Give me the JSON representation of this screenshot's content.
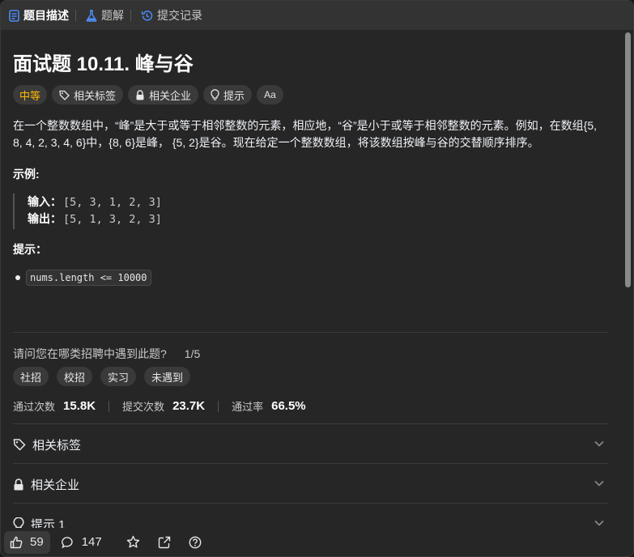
{
  "tabs": [
    {
      "label": "题目描述",
      "icon": "document-icon",
      "active": true
    },
    {
      "label": "题解",
      "icon": "flask-icon",
      "active": false
    },
    {
      "label": "提交记录",
      "icon": "history-icon",
      "active": false
    }
  ],
  "problem": {
    "title": "面试题 10.11. 峰与谷",
    "difficulty": "中等",
    "tag_buttons": [
      "相关标签",
      "相关企业",
      "提示",
      "Aa"
    ],
    "description_line1": "在一个整数数组中，“峰”是大于或等于相邻整数的元素，相应地，“谷”是小于或等于相邻整数的元素。例如，在数组{5,",
    "description_line2": "8, 4, 2, 3, 4, 6}中，{8, 6}是峰， {5, 2}是谷。现在给定一个整数数组，将该数组按峰与谷的交替顺序排序。",
    "example_heading": "示例:",
    "input_label": "输入：",
    "input_value": "[5, 3, 1, 2, 3]",
    "output_label": "输出：",
    "output_value": "[5, 1, 3, 2, 3]",
    "hints_heading": "提示：",
    "hint_code": "nums.length <= 10000"
  },
  "survey": {
    "question": "请问您在哪类招聘中遇到此题?",
    "page": "1/5",
    "options": [
      "社招",
      "校招",
      "实习",
      "未遇到"
    ]
  },
  "stats": {
    "accepted_label": "通过次数",
    "accepted_value": "15.8K",
    "submissions_label": "提交次数",
    "submissions_value": "23.7K",
    "rate_label": "通过率",
    "rate_value": "66.5%"
  },
  "sections": [
    {
      "label": "相关标签",
      "icon": "tag-icon"
    },
    {
      "label": "相关企业",
      "icon": "lock-icon"
    },
    {
      "label": "提示 1",
      "icon": "lightbulb-icon"
    }
  ],
  "bottom": {
    "likes": "59",
    "comments": "147"
  },
  "colors": {
    "background": "#262626",
    "tabbar": "#333333",
    "difficulty_medium": "#ffb800"
  }
}
